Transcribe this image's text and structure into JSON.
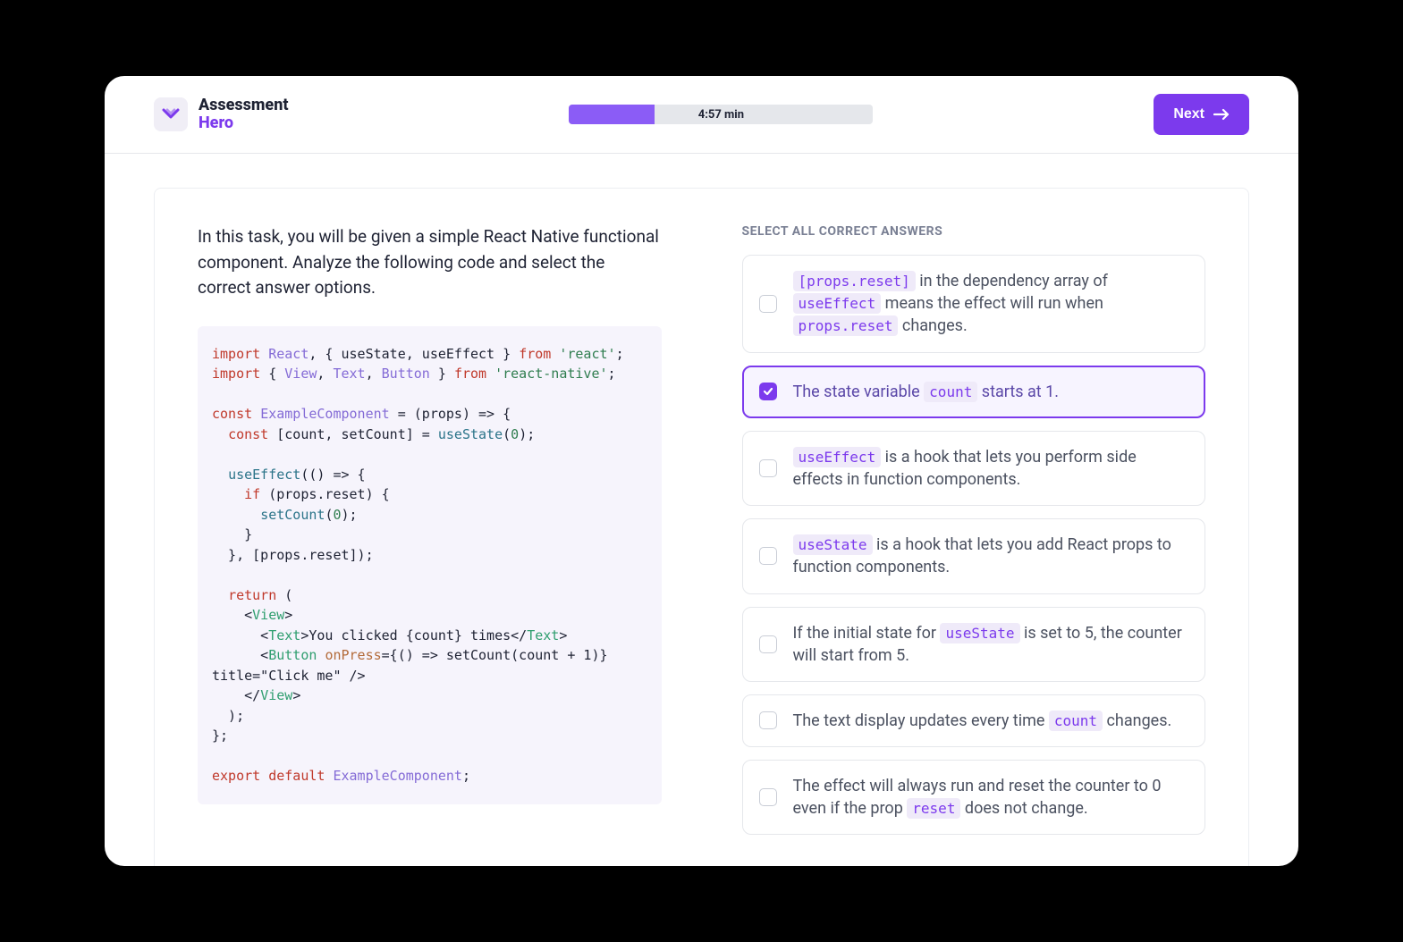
{
  "header": {
    "brand_line1": "Assessment",
    "brand_line2": "Hero",
    "timer_text": "4:57 min",
    "timer_progress_pct": 28,
    "next_label": "Next"
  },
  "question": {
    "prompt": "In this task, you will be given a simple React Native functional component. Analyze the following code and select the correct answer options.",
    "section_label": "SELECT ALL CORRECT ANSWERS",
    "code_tokens": [
      [
        {
          "t": "kw",
          "v": "import"
        },
        {
          "v": " "
        },
        {
          "t": "cls",
          "v": "React"
        },
        {
          "v": ", { useState, useEffect } "
        },
        {
          "t": "kw",
          "v": "from"
        },
        {
          "v": " "
        },
        {
          "t": "str",
          "v": "'react'"
        },
        {
          "v": ";"
        }
      ],
      [
        {
          "t": "kw",
          "v": "import"
        },
        {
          "v": " { "
        },
        {
          "t": "cls",
          "v": "View"
        },
        {
          "v": ", "
        },
        {
          "t": "cls",
          "v": "Text"
        },
        {
          "v": ", "
        },
        {
          "t": "cls",
          "v": "Button"
        },
        {
          "v": " } "
        },
        {
          "t": "kw",
          "v": "from"
        },
        {
          "v": " "
        },
        {
          "t": "str",
          "v": "'react-native'"
        },
        {
          "v": ";"
        }
      ],
      [],
      [
        {
          "t": "kw",
          "v": "const"
        },
        {
          "v": " "
        },
        {
          "t": "cls",
          "v": "ExampleComponent"
        },
        {
          "v": " = (props) => {"
        }
      ],
      [
        {
          "v": "  "
        },
        {
          "t": "kw",
          "v": "const"
        },
        {
          "v": " [count, setCount] = "
        },
        {
          "t": "fn",
          "v": "useState"
        },
        {
          "v": "("
        },
        {
          "t": "num",
          "v": "0"
        },
        {
          "v": ");"
        }
      ],
      [],
      [
        {
          "v": "  "
        },
        {
          "t": "fn",
          "v": "useEffect"
        },
        {
          "v": "(() => {"
        }
      ],
      [
        {
          "v": "    "
        },
        {
          "t": "kw",
          "v": "if"
        },
        {
          "v": " (props.reset) {"
        }
      ],
      [
        {
          "v": "      "
        },
        {
          "t": "fn",
          "v": "setCount"
        },
        {
          "v": "("
        },
        {
          "t": "num",
          "v": "0"
        },
        {
          "v": ");"
        }
      ],
      [
        {
          "v": "    }"
        }
      ],
      [
        {
          "v": "  }, [props.reset]);"
        }
      ],
      [],
      [
        {
          "v": "  "
        },
        {
          "t": "kw",
          "v": "return"
        },
        {
          "v": " ("
        }
      ],
      [
        {
          "v": "    <"
        },
        {
          "t": "tag",
          "v": "View"
        },
        {
          "v": ">"
        }
      ],
      [
        {
          "v": "      <"
        },
        {
          "t": "tag",
          "v": "Text"
        },
        {
          "v": ">You clicked {count} times</"
        },
        {
          "t": "tag",
          "v": "Text"
        },
        {
          "v": ">"
        }
      ],
      [
        {
          "v": "      <"
        },
        {
          "t": "tag",
          "v": "Button"
        },
        {
          "v": " "
        },
        {
          "t": "attr",
          "v": "onPress"
        },
        {
          "v": "={() => setCount(count + 1)}"
        }
      ],
      [
        {
          "v": "title=\"Click me\" />"
        }
      ],
      [
        {
          "v": "    </"
        },
        {
          "t": "tag",
          "v": "View"
        },
        {
          "v": ">"
        }
      ],
      [
        {
          "v": "  );"
        }
      ],
      [
        {
          "v": "};"
        }
      ],
      [],
      [
        {
          "t": "kw",
          "v": "export"
        },
        {
          "v": " "
        },
        {
          "t": "kw",
          "v": "default"
        },
        {
          "v": " "
        },
        {
          "t": "cls",
          "v": "ExampleComponent"
        },
        {
          "v": ";"
        }
      ]
    ],
    "options": [
      {
        "id": "opt-1",
        "selected": false,
        "parts": [
          {
            "code": "[props.reset]"
          },
          {
            "text": " in the dependency array of "
          },
          {
            "code": "useEffect"
          },
          {
            "text": " means the effect will run when "
          },
          {
            "code": "props.reset"
          },
          {
            "text": " changes."
          }
        ]
      },
      {
        "id": "opt-2",
        "selected": true,
        "parts": [
          {
            "text": "The state variable "
          },
          {
            "code": "count"
          },
          {
            "text": " starts at 1."
          }
        ]
      },
      {
        "id": "opt-3",
        "selected": false,
        "parts": [
          {
            "code": "useEffect"
          },
          {
            "text": " is a hook that lets you perform side effects in function components."
          }
        ]
      },
      {
        "id": "opt-4",
        "selected": false,
        "parts": [
          {
            "code": "useState"
          },
          {
            "text": " is a hook that lets you add React props to function components."
          }
        ]
      },
      {
        "id": "opt-5",
        "selected": false,
        "parts": [
          {
            "text": "If the initial state for "
          },
          {
            "code": "useState"
          },
          {
            "text": " is set to 5, the counter will start from 5."
          }
        ]
      },
      {
        "id": "opt-6",
        "selected": false,
        "parts": [
          {
            "text": "The text display updates every time "
          },
          {
            "code": "count"
          },
          {
            "text": " changes."
          }
        ]
      },
      {
        "id": "opt-7",
        "selected": false,
        "parts": [
          {
            "text": "The effect will always run and reset the counter to 0 even if the prop "
          },
          {
            "code": "reset"
          },
          {
            "text": " does not change."
          }
        ]
      }
    ]
  }
}
